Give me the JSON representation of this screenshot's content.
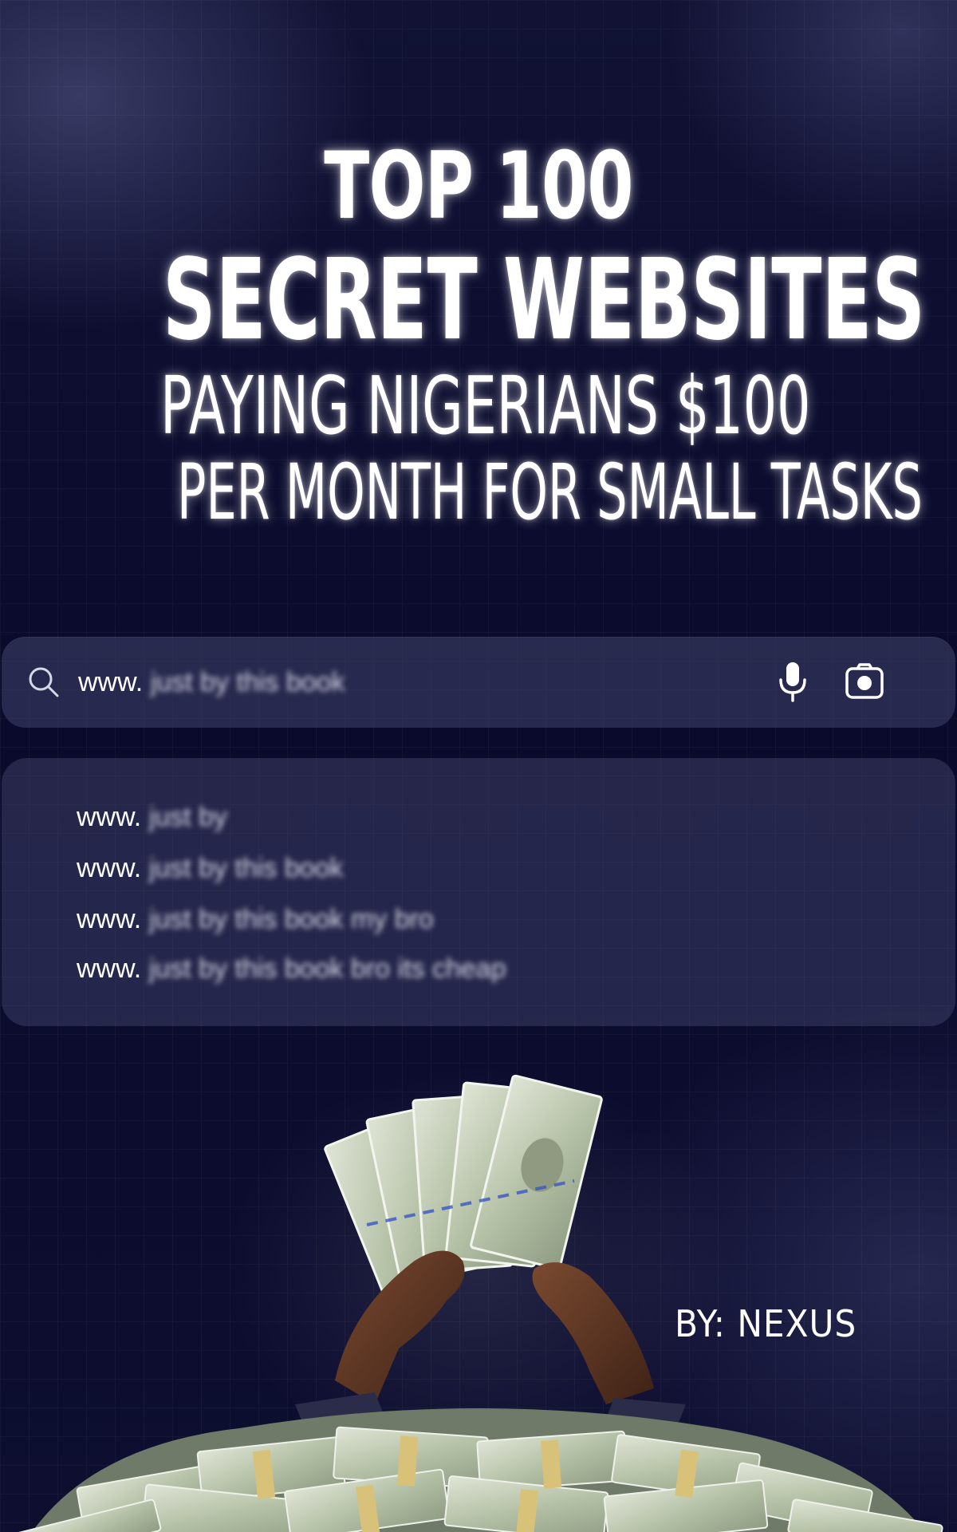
{
  "headline": {
    "line1": "TOP 100",
    "line2": "SECRET WEBSITES",
    "line3": "PAYING NIGERIANS $100",
    "line4": "PER MONTH FOR SMALL TASKS"
  },
  "search": {
    "prefix": "www.",
    "blurred_text": "just by this book",
    "icons": [
      "search-icon",
      "mic-icon",
      "camera-icon"
    ]
  },
  "suggestions": [
    {
      "prefix": "www.",
      "blurred_text": "just by"
    },
    {
      "prefix": "www.",
      "blurred_text": "just by this book"
    },
    {
      "prefix": "www.",
      "blurred_text": "just by this book my bro"
    },
    {
      "prefix": "www.",
      "blurred_text": "just by this book bro its cheap"
    }
  ],
  "byline": "BY: NEXUS",
  "colors": {
    "background": "#0b0b2a",
    "panel": "#3c3e64",
    "text": "#ffffff",
    "money_green": "#a9b79a",
    "skin": "#5a3422"
  }
}
